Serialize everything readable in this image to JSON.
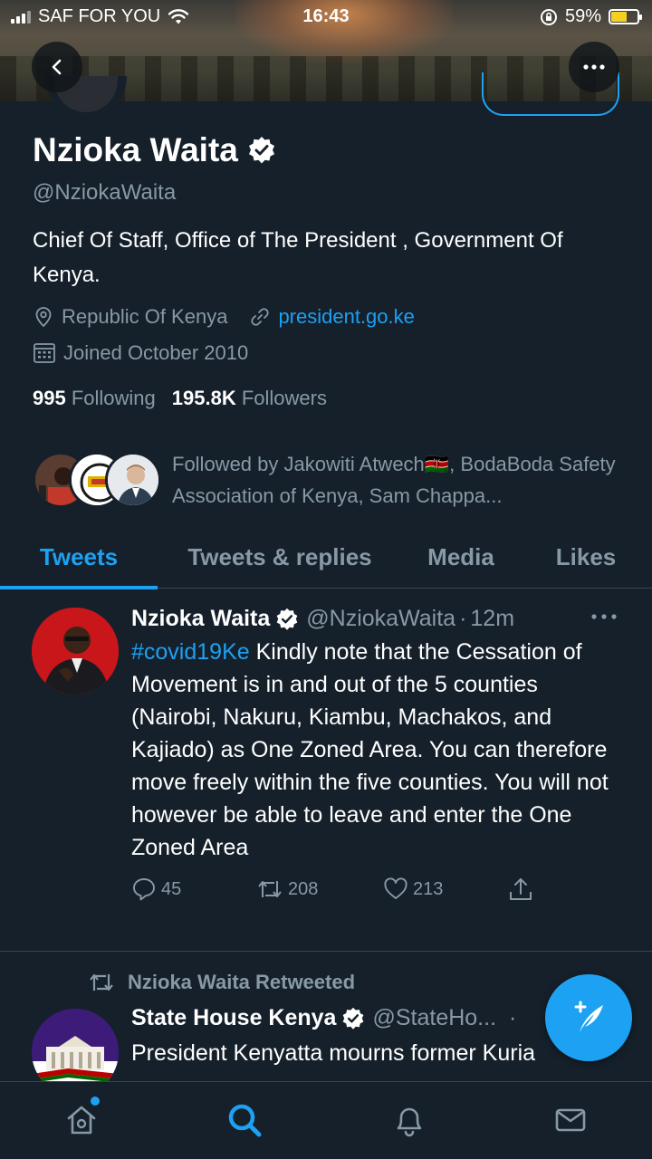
{
  "status_bar": {
    "carrier": "SAF FOR YOU",
    "time": "16:43",
    "battery": "59%",
    "battery_level": 0.59,
    "battery_color": "#f5d020"
  },
  "header": {
    "back_icon": "chevron-left-icon",
    "more_icon": "more-horizontal-icon"
  },
  "profile": {
    "name": "Nzioka Waita",
    "verified": true,
    "handle": "@NziokaWaita",
    "bio": "Chief Of Staff, Office of The President , Government Of Kenya.",
    "location": "Republic Of Kenya",
    "website": "president.go.ke",
    "joined": "Joined October 2010",
    "following_count": "995",
    "following_label": "Following",
    "followers_count": "195.8K",
    "followers_label": "Followers",
    "followed_by": "Followed by Jakowiti Atwech🇰🇪, BodaBoda Safety Association of Kenya, Sam Chappa..."
  },
  "tabs": [
    {
      "label": "Tweets",
      "active": true
    },
    {
      "label": "Tweets & replies",
      "active": false
    },
    {
      "label": "Media",
      "active": false
    },
    {
      "label": "Likes",
      "active": false
    }
  ],
  "tweet": {
    "name": "Nzioka Waita",
    "handle": "@NziokaWaita",
    "separator": "·",
    "time": "12m",
    "hashtag": "#covid19Ke",
    "text": " Kindly note that the Cessation of Movement is in and out of the 5 counties (Nairobi, Nakuru, Kiambu, Machakos, and Kajiado) as One Zoned Area. You can therefore move freely within the five counties. You will not however be able to leave and enter the One Zoned Area",
    "replies": "45",
    "retweets": "208",
    "likes": "213"
  },
  "retweet": {
    "label": "Nzioka Waita Retweeted",
    "name": "State House Kenya",
    "handle": "@StateHo...",
    "separator": "·",
    "text": "President Kenyatta mourns former Kuria"
  },
  "colors": {
    "background": "#15202b",
    "accent": "#1da1f2",
    "secondary_text": "#8899a6",
    "divider": "#38444d"
  }
}
